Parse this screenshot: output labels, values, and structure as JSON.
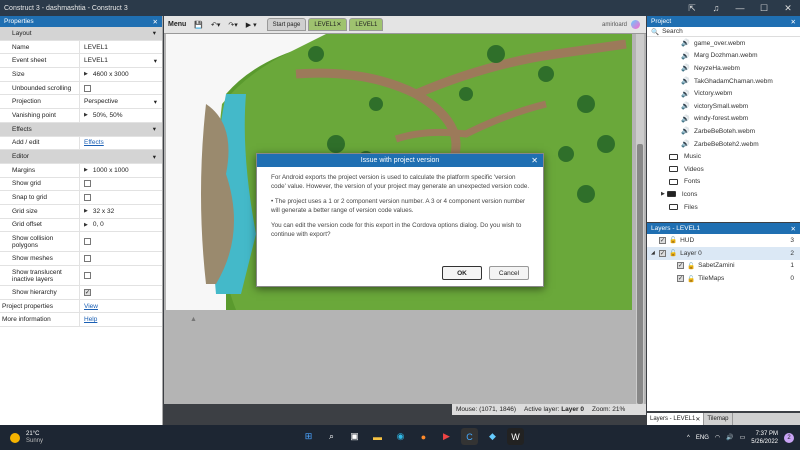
{
  "window": {
    "title": "Construct 3 - dashmashtia - Construct 3"
  },
  "properties": {
    "header": "Properties",
    "rows": [
      {
        "type": "section",
        "label": "Layout"
      },
      {
        "type": "text",
        "label": "Name",
        "value": "LEVEL1"
      },
      {
        "type": "select",
        "label": "Event sheet",
        "value": "LEVEL1"
      },
      {
        "type": "expand",
        "label": "Size",
        "value": "4600 x 3000"
      },
      {
        "type": "check",
        "label": "Unbounded scrolling",
        "checked": false
      },
      {
        "type": "select",
        "label": "Projection",
        "value": "Perspective"
      },
      {
        "type": "expand",
        "label": "Vanishing point",
        "value": "50%, 50%"
      },
      {
        "type": "section",
        "label": "Effects"
      },
      {
        "type": "link",
        "label": "Add / edit",
        "value": "Effects"
      },
      {
        "type": "section",
        "label": "Editor"
      },
      {
        "type": "expand",
        "label": "Margins",
        "value": "1000 x 1000"
      },
      {
        "type": "check",
        "label": "Show grid",
        "checked": false
      },
      {
        "type": "check",
        "label": "Snap to grid",
        "checked": false
      },
      {
        "type": "expand",
        "label": "Grid size",
        "value": "32 x 32"
      },
      {
        "type": "expand",
        "label": "Grid offset",
        "value": "0, 0"
      },
      {
        "type": "check",
        "label": "Show collision polygons",
        "checked": false,
        "tall": true
      },
      {
        "type": "check",
        "label": "Show meshes",
        "checked": false
      },
      {
        "type": "check",
        "label": "Show translucent inactive layers",
        "checked": false,
        "tall": true
      },
      {
        "type": "check",
        "label": "Show hierarchy",
        "checked": true
      },
      {
        "type": "rootlink",
        "label": "Project properties",
        "value": "View"
      },
      {
        "type": "rootlink",
        "label": "More information",
        "value": "Help"
      }
    ]
  },
  "toolbar": {
    "menu_label": "Menu",
    "tabs": [
      "Start page",
      "LEVEL1",
      "LEVEL1"
    ],
    "user": "amirloard"
  },
  "project": {
    "header": "Project",
    "search_label": "Search",
    "sounds": [
      "game_over.webm",
      "Marg Dozhman.webm",
      "NeyzeHa.webm",
      "TakGhadamChaman.webm",
      "Victory.webm",
      "victorySmall.webm",
      "windy-forest.webm",
      "ZarbeBeBoteh.webm",
      "ZarbeBeBoteh2.webm"
    ],
    "folders": [
      {
        "name": "Music",
        "filled": false,
        "expand": false
      },
      {
        "name": "Videos",
        "filled": false,
        "expand": false
      },
      {
        "name": "Fonts",
        "filled": false,
        "expand": false
      },
      {
        "name": "Icons",
        "filled": true,
        "expand": true
      },
      {
        "name": "Files",
        "filled": false,
        "expand": false
      }
    ]
  },
  "layers": {
    "header": "Layers - LEVEL1",
    "items": [
      {
        "name": "HUD",
        "num": "3",
        "indent": 0,
        "expand": false,
        "selected": false
      },
      {
        "name": "Layer 0",
        "num": "2",
        "indent": 0,
        "expand": true,
        "selected": true
      },
      {
        "name": "SabetZamini",
        "num": "1",
        "indent": 1,
        "expand": false,
        "selected": false
      },
      {
        "name": "TileMaps",
        "num": "0",
        "indent": 1,
        "expand": false,
        "selected": false
      }
    ],
    "tabs": [
      "Layers - LEVEL1",
      "Tilemap"
    ]
  },
  "status": {
    "mouse": "Mouse: (1071, 1846)",
    "active_prefix": "Active layer:",
    "active_layer": "Layer 0",
    "zoom": "Zoom: 21%"
  },
  "dialog": {
    "title": "Issue with project version",
    "p1": "For Android exports the project version is used to calculate the platform specific 'version code' value. However, the version of your project may generate an unexpected version code.",
    "p2": "• The project uses a 1 or 2 component version number. A 3 or 4 component version number will generate a better range of version code values.",
    "p3": "You can edit the version code for this export in the Cordova options dialog. Do you wish to continue with export?",
    "ok": "OK",
    "cancel": "Cancel"
  },
  "taskbar": {
    "temp": "21°C",
    "weather": "Sunny",
    "lang": "ENG",
    "time": "7:37 PM",
    "date": "5/26/2022",
    "notif": "2"
  }
}
